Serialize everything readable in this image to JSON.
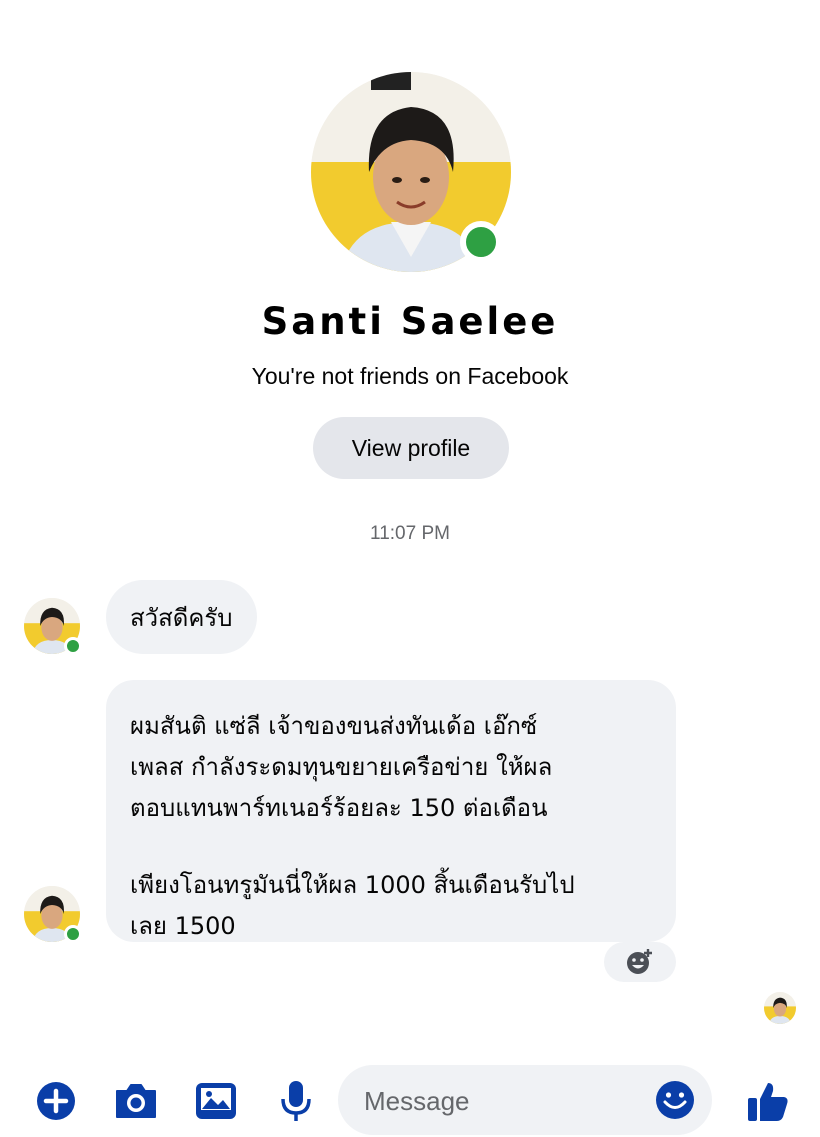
{
  "contact": {
    "name": "Santi Saelee",
    "relationship": "You're not friends on Facebook",
    "view_profile_label": "View profile",
    "online": true
  },
  "conversation": {
    "timestamp": "11:07 PM",
    "messages": [
      {
        "sender": "Santi Saelee",
        "lines": [
          "สวัสดีครับ"
        ]
      },
      {
        "sender": "Santi Saelee",
        "paragraphs": [
          [
            "ผมสันติ แซ่ลี เจ้าของขนส่งทันเด้อ เอ๊กซ์",
            "เพลส กำลังระดมทุนขยายเครือข่าย ให้ผล",
            "ตอบแทนพาร์ทเนอร์ร้อยละ 150 ต่อเดือน"
          ],
          [
            "เพียงโอนทรูมันนี่ให้ผล 1000 สิ้นเดือนรับไป",
            "เลย 1500"
          ]
        ]
      }
    ]
  },
  "composer": {
    "placeholder": "Message",
    "icons": [
      "plus-circle-icon",
      "camera-icon",
      "gallery-icon",
      "microphone-icon",
      "emoji-icon",
      "thumbs-up-icon"
    ]
  },
  "colors": {
    "accent": "#0a3ea8",
    "bubble": "#f0f2f5",
    "button": "#e4e6eb",
    "online": "#2ea043",
    "secondary_text": "#65676b"
  }
}
